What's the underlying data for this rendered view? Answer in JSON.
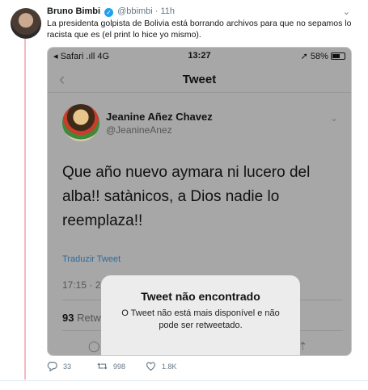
{
  "tweet": {
    "author_name": "Bruno Bimbi",
    "author_handle": "@bbimbi",
    "separator": "·",
    "time": "11h",
    "text": "La presidenta golpista de Bolivia está borrando archivos para que no sepamos lo racista que es (el print lo hice yo mismo).",
    "caret": "⌄"
  },
  "screenshot": {
    "status": {
      "carrier": "◂ Safari .ıll 4G",
      "time": "13:27",
      "battery": "➚ 58%"
    },
    "nav": {
      "back": "‹",
      "title": "Tweet"
    },
    "inner_tweet": {
      "name": "Jeanine Añez Chavez",
      "handle": "@JeanineAnez",
      "text": "Que año nuevo aymara ni lucero del alba!! satànicos, a Dios nadie lo reemplaza!!",
      "translate": "Traduzir Tweet",
      "time": "17:15 · 2",
      "retweet_count": "93",
      "retweet_label": "Retw"
    },
    "alert": {
      "title": "Tweet não encontrado",
      "message": "O Tweet não está mais disponível e não pode ser retweetado."
    }
  },
  "actions": {
    "replies": "33",
    "retweets": "998",
    "likes": "1.8K"
  },
  "colors": {
    "accent": "#1da1f2",
    "thread_line": "#f2b9c6",
    "overlay": "#a7a7a7"
  }
}
